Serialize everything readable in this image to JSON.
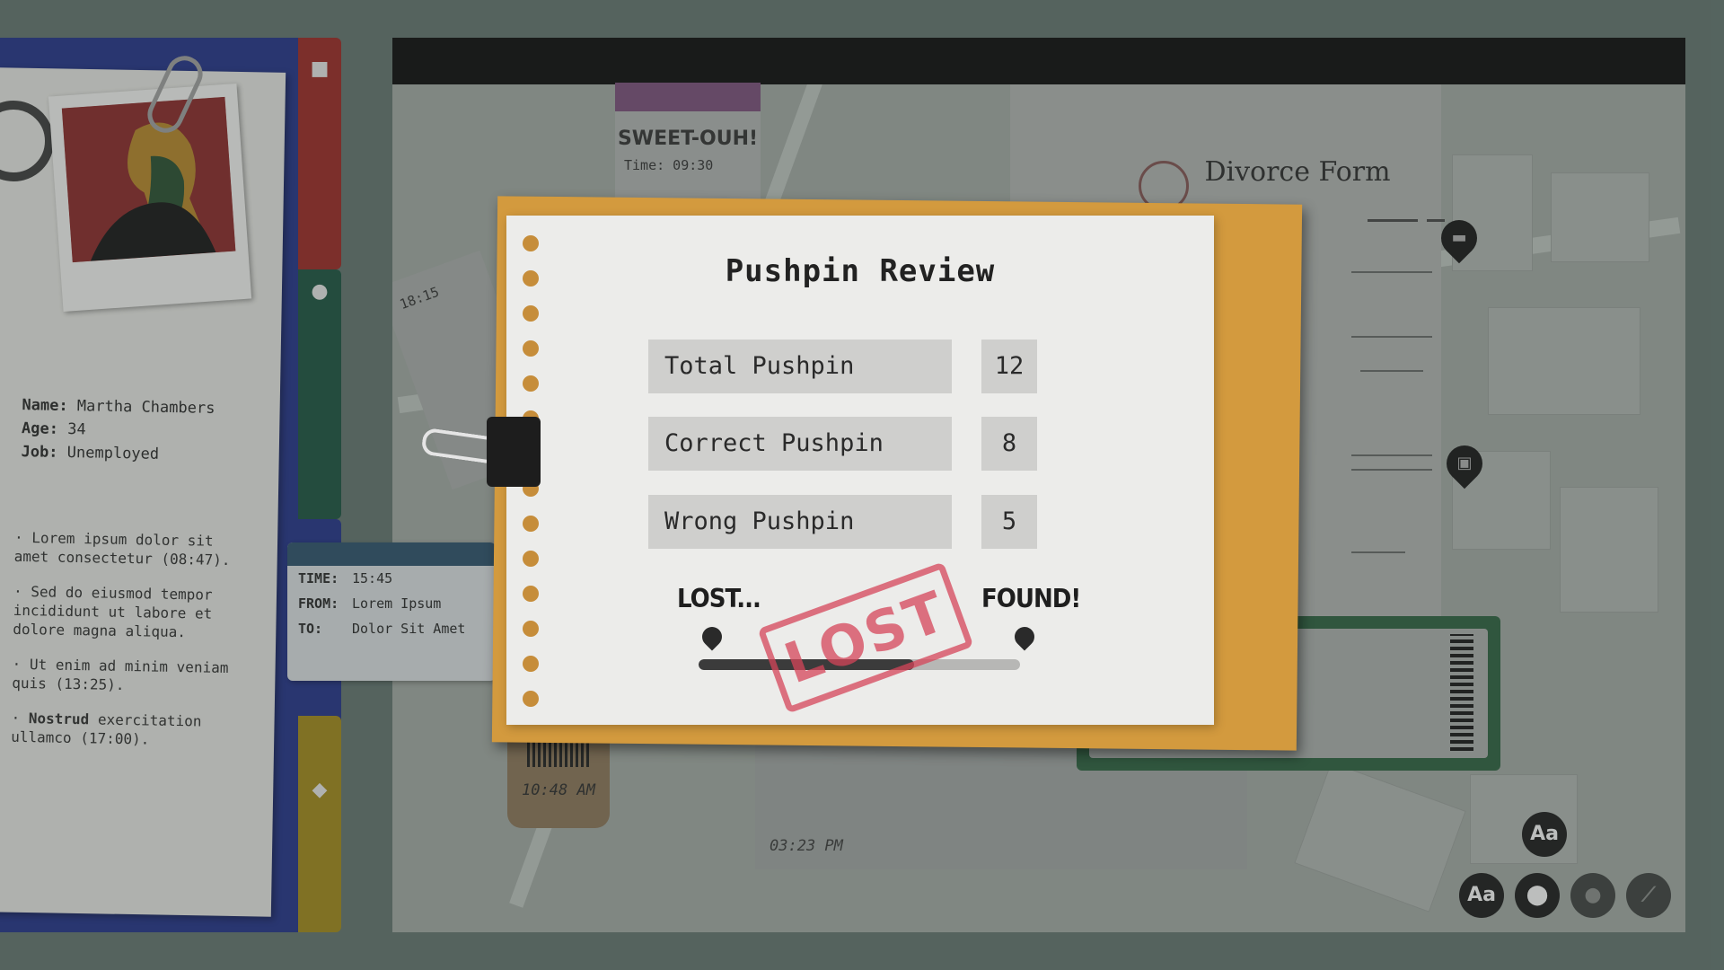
{
  "case_file": {
    "name_label": "Name:",
    "name": "Martha Chambers",
    "age_label": "Age:",
    "age": "34",
    "job_label": "Job:",
    "job": "Unemployed",
    "notes": [
      {
        "bold": "",
        "text": "· Lorem ipsum dolor sit amet consectetur (08:47)."
      },
      {
        "bold": "",
        "text": "· Sed do eiusmod tempor incididunt ut labore et dolore magna aliqua."
      },
      {
        "bold": "",
        "text": "· Ut enim ad minim veniam quis (13:25)."
      },
      {
        "bold": "Nostrud",
        "text": "exercitation ullamco (17:00)."
      }
    ],
    "tab_icons": [
      "square",
      "circle",
      "triangle",
      "diamond"
    ]
  },
  "message_ticket": {
    "time_label": "TIME:",
    "time": "15:45",
    "from_label": "FROM:",
    "from": "Lorem Ipsum",
    "to_label": "TO:",
    "to": "Dolor Sit Amet"
  },
  "board": {
    "sweet_ticket": {
      "title": "SWEET-OUH!",
      "time": "Time: 09:30"
    },
    "receipt_time": "18:15",
    "barcode_ticket_time": "10:48 AM",
    "receipt2_time": "03:23 PM",
    "divorce_form_title": "Divorce Form",
    "map_pins": [
      "bed-icon",
      "cinema-icon"
    ],
    "tools": [
      {
        "name": "font-size-button",
        "label": "Aa"
      },
      {
        "name": "font-button",
        "label": "Aa"
      },
      {
        "name": "map-pin-tool",
        "icon": "location-pin-icon"
      },
      {
        "name": "pushpin-tool",
        "icon": "pushpin-icon"
      },
      {
        "name": "string-tool",
        "icon": "string-link-icon"
      }
    ]
  },
  "pushpin_review": {
    "title": "Pushpin Review",
    "stats": [
      {
        "label": "Total Pushpin",
        "value": "12"
      },
      {
        "label": "Correct Pushpin",
        "value": "8"
      },
      {
        "label": "Wrong Pushpin",
        "value": "5"
      }
    ],
    "lost_label": "LOST...",
    "found_label": "FOUND!",
    "progress_fraction": 0.67,
    "stamp_text": "LOST",
    "colors": {
      "folder_back": "#d39a3e",
      "stamp": "#d6465a"
    }
  }
}
